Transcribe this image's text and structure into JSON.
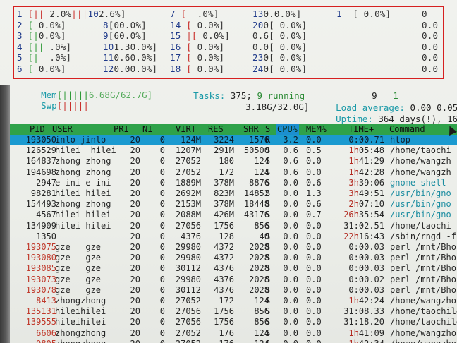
{
  "cpus": [
    {
      "num": "1",
      "bar": "||",
      "val": "2.0%",
      "bar_color": "r"
    },
    {
      "num": "2",
      "bar": "",
      "val": "0.0%"
    },
    {
      "num": "3",
      "bar": "|",
      "val": "0.0%",
      "bar_color": "r"
    },
    {
      "num": "4",
      "bar": "||",
      "val": ".0%",
      "bar_color": "g"
    },
    {
      "num": "5",
      "bar": "|",
      "val": ".0%",
      "bar_color": "g"
    },
    {
      "num": "6",
      "bar": "",
      "val": "0.0%"
    },
    {
      "num": "7",
      "bar": "",
      "val": ".0%"
    },
    {
      "num": "8",
      "bar": "",
      "val": "00.0%"
    },
    {
      "num": "9",
      "bar": "",
      "val": "60.0%"
    },
    {
      "num": "10",
      "bar": "",
      "val": "1.30.0%"
    },
    {
      "num": "11",
      "bar": "",
      "val": "0.60.0%"
    },
    {
      "num": "12",
      "bar": "",
      "val": "0.00.0%"
    },
    {
      "num": "13",
      "bar": "",
      "val": "0.0.0%"
    },
    {
      "num": "14",
      "bar": "|",
      "val": "0.0%"
    },
    {
      "num": "15",
      "bar": "|",
      "val": "0.0%"
    },
    {
      "num": "16",
      "bar": "",
      "val": "0.0%"
    },
    {
      "num": "17",
      "bar": "",
      "val": "0.0%"
    },
    {
      "num": "18",
      "bar": "",
      "val": "0.0%"
    },
    {
      "num": "1",
      "bar": "",
      "val": "0.0%"
    },
    {
      "num": "20",
      "bar": "",
      "val": "0.0%"
    },
    {
      "num": "21",
      "bar": "",
      "val": "0.0%"
    },
    {
      "num": "22",
      "bar": "",
      "val": "0.0%"
    },
    {
      "num": "23",
      "bar": "",
      "val": "0.0%"
    },
    {
      "num": "24",
      "bar": "",
      "val": "0.0%"
    }
  ],
  "cpu_labels_raw": {
    "r1": [
      "1",
      "[||",
      "2.0%|||10",
      "2.6%]",
      "7",
      "[",
      ".0%]",
      "13",
      "0.0.0%]",
      "1",
      "[",
      "0.0%]",
      "0"
    ],
    "col_right": [
      "0",
      "0.0",
      "0.0",
      "0.0",
      "0.0",
      "0.0"
    ]
  },
  "cpu_rows": [
    {
      "a": "1",
      "abar": "[||",
      "aval": " 2.0%",
      "mid": "|||10",
      "mval": "2.6%]",
      "b": "7",
      "bbar": "[",
      "bval": "  .0%]",
      "c": "13",
      "cval": "0.0.0%]",
      "d": "1",
      "dbar": "[",
      "dval": " 0.0%]",
      "e": "0"
    },
    {
      "a": "2",
      "abar": "[",
      "aval": " 0.0%]",
      "mid": "8",
      "mval": "[00.0%]",
      "b": "14",
      "bbar": "[",
      "bval": " 0.0%]",
      "c": "20",
      "cval": "0[ 0.0%]",
      "d": "",
      "dbar": "",
      "dval": "",
      "e": "0.0"
    },
    {
      "a": "3",
      "abar": "[|",
      "aval": "0.0%]",
      "mid": "9",
      "mval": "[60.0%]",
      "b": "15",
      "bbar": "|[",
      "bval": " 0.0%]",
      "c": "",
      "cval": "0.6[ 0.0%]",
      "d": "",
      "dbar": "",
      "dval": "",
      "e": "0.0"
    },
    {
      "a": "4",
      "abar": "[||",
      "aval": " .0%]",
      "mid": "10",
      "mval": "1.30.0%]",
      "b": "16",
      "bbar": "[",
      "bval": " 0.0%]",
      "c": "",
      "cval": "0.0[ 0.0%]",
      "d": "",
      "dbar": "",
      "dval": "",
      "e": "0.0"
    },
    {
      "a": "5",
      "abar": "[|",
      "aval": "  .0%]",
      "mid": "11",
      "mval": "0.60.0%]",
      "b": "17",
      "bbar": "[",
      "bval": " 0.0%]",
      "c": "23",
      "cval": "0[ 0.0%]",
      "d": "",
      "dbar": "",
      "dval": "",
      "e": "0.0"
    },
    {
      "a": "6",
      "abar": "[",
      "aval": " 0.0%]",
      "mid": "12",
      "mval": "0.00.0%]",
      "b": "18",
      "bbar": "[",
      "bval": " 0.0%]",
      "c": "24",
      "cval": "0[ 0.0%]",
      "d": "",
      "dbar": "",
      "dval": "",
      "e": "0.0"
    }
  ],
  "meters": {
    "mem_label": "Mem",
    "mem_bar": "[|||||",
    "mem_val": "6.68G/62.7G]",
    "swp_label": "Swp",
    "swp_bar": "[|||||",
    "swp_val": "3.18G/32.0G]",
    "tasks_label": "Tasks:",
    "tasks_count": "375;",
    "running": "9 running",
    "right_9": "9",
    "right_1": "1",
    "load_label": "Load average:",
    "load_vals": "0.00 0.05",
    "uptime_label": "Uptime:",
    "uptime_val": "364 days(!), 16:"
  },
  "columns": [
    "PID",
    "USER",
    "PRI",
    "NI",
    "VIRT",
    "RES",
    "SHR",
    "S",
    "CPU%",
    "MEM%",
    "TIME+",
    "Command"
  ],
  "processes": [
    {
      "pid": "193050",
      "user": "inlo jinlo",
      "pri": "20",
      "ni": "0",
      "virt": "124M",
      "res": "3224",
      "shr": "1576",
      "s": "R",
      "cpu": "3.2",
      "mem": "0.0",
      "time_h": "",
      "time": "0:00.71",
      "cmd": "htop",
      "selected": true
    },
    {
      "pid": "126529",
      "user": "hilei  hilei",
      "pri": "20",
      "ni": "0",
      "virt": "1207M",
      "res": "291M",
      "shr": "50500",
      "s": "S",
      "cpu": "0.6",
      "mem": "0.5",
      "time_h": "1h",
      "time": "05:48",
      "cmd": "/home/taochi"
    },
    {
      "pid": "164837",
      "user": "zhong zhong",
      "pri": "20",
      "ni": "0",
      "virt": "27052",
      "res": "180",
      "shr": "124",
      "s": "S",
      "cpu": "0.6",
      "mem": "0.0",
      "time_h": "1h",
      "time": "41:29",
      "cmd": "/home/wangzh"
    },
    {
      "pid": "194698",
      "user": "zhong zhong",
      "pri": "20",
      "ni": "0",
      "virt": "27052",
      "res": "172",
      "shr": "124",
      "s": "S",
      "cpu": "0.6",
      "mem": "0.0",
      "time_h": "1h",
      "time": "42:28",
      "cmd": "/home/wangzh"
    },
    {
      "pid": "2947",
      "user": "e-ini e-ini",
      "pri": "20",
      "ni": "0",
      "virt": "1889M",
      "res": "378M",
      "shr": "8876",
      "s": "S",
      "cpu": "0.0",
      "mem": "0.6",
      "time_h": "3h",
      "time": "39:06",
      "cmd": "gnome-shell"
    },
    {
      "pid": "98281",
      "user": "hilei hilei",
      "pri": "20",
      "ni": "0",
      "virt": "2692M",
      "res": "823M",
      "shr": "14852",
      "s": "S",
      "cpu": "0.0",
      "mem": "1.3",
      "time_h": "3h",
      "time": "49:51",
      "cmd": "/usr/bin/gno"
    },
    {
      "pid": "154493",
      "user": "zhong zhong",
      "pri": "20",
      "ni": "0",
      "virt": "2153M",
      "res": "378M",
      "shr": "18448",
      "s": "S",
      "cpu": "0.0",
      "mem": "0.6",
      "time_h": "2h",
      "time": "07:10",
      "cmd": "/usr/bin/gno"
    },
    {
      "pid": "4567",
      "user": "hilei hilei",
      "pri": "20",
      "ni": "0",
      "virt": "2088M",
      "res": "426M",
      "shr": "43176",
      "s": "S",
      "cpu": "0.0",
      "mem": "0.7",
      "time_h": "26h",
      "time": "35:54",
      "cmd": "/usr/bin/gno"
    },
    {
      "pid": "134909",
      "user": "hilei hilei",
      "pri": "20",
      "ni": "0",
      "virt": "27056",
      "res": "1756",
      "shr": "856",
      "s": "S",
      "cpu": "0.0",
      "mem": "0.0",
      "time_h": "",
      "time": "31:02.51",
      "cmd": "/home/taochi"
    },
    {
      "pid": "1350",
      "user": "",
      "pri": "20",
      "ni": "0",
      "virt": "4376",
      "res": "128",
      "shr": "40",
      "s": "S",
      "cpu": "0.0",
      "mem": "0.0",
      "time_h": "22h",
      "time": "16:43",
      "cmd": "/sbin/rngd -f"
    },
    {
      "pid": "193075",
      "user": "gze   gze",
      "pri": "20",
      "ni": "0",
      "virt": "29980",
      "res": "4372",
      "shr": "2028",
      "s": "S",
      "cpu": "0.0",
      "mem": "0.0",
      "time_h": "",
      "time": "0:00.03",
      "cmd": "perl /mnt/Bho"
    },
    {
      "pid": "193080",
      "user": "gze   gze",
      "pri": "20",
      "ni": "0",
      "virt": "29980",
      "res": "4372",
      "shr": "2028",
      "s": "S",
      "cpu": "0.0",
      "mem": "0.0",
      "time_h": "",
      "time": "0:00.03",
      "cmd": "perl /mnt/Bho"
    },
    {
      "pid": "193085",
      "user": "gze   gze",
      "pri": "20",
      "ni": "0",
      "virt": "30112",
      "res": "4376",
      "shr": "2028",
      "s": "S",
      "cpu": "0.0",
      "mem": "0.0",
      "time_h": "",
      "time": "0:00.03",
      "cmd": "perl /mnt/Bho"
    },
    {
      "pid": "193073",
      "user": "gze   gze",
      "pri": "20",
      "ni": "0",
      "virt": "29980",
      "res": "4376",
      "shr": "2028",
      "s": "S",
      "cpu": "0.0",
      "mem": "0.0",
      "time_h": "",
      "time": "0:00.02",
      "cmd": "perl /mnt/Bho"
    },
    {
      "pid": "193078",
      "user": "gze   gze",
      "pri": "20",
      "ni": "0",
      "virt": "30112",
      "res": "4376",
      "shr": "2028",
      "s": "S",
      "cpu": "0.0",
      "mem": "0.0",
      "time_h": "",
      "time": "0:00.03",
      "cmd": "perl /mnt/Bhor"
    },
    {
      "pid": "8413",
      "user": "zhongzhong",
      "pri": "20",
      "ni": "0",
      "virt": "27052",
      "res": "172",
      "shr": "124",
      "s": "S",
      "cpu": "0.0",
      "mem": "0.0",
      "time_h": "1h",
      "time": "42:24",
      "cmd": "/home/wangzhon"
    },
    {
      "pid": "135131",
      "user": "hileihilei",
      "pri": "20",
      "ni": "0",
      "virt": "27056",
      "res": "1756",
      "shr": "856",
      "s": "S",
      "cpu": "0.0",
      "mem": "0.0",
      "time_h": "",
      "time": "31:08.33",
      "cmd": "/home/taochile"
    },
    {
      "pid": "139555",
      "user": "hileihilei",
      "pri": "20",
      "ni": "0",
      "virt": "27056",
      "res": "1756",
      "shr": "856",
      "s": "S",
      "cpu": "0.0",
      "mem": "0.0",
      "time_h": "",
      "time": "31:18.20",
      "cmd": "/home/taochile"
    },
    {
      "pid": "6606",
      "user": "zhongzhong",
      "pri": "20",
      "ni": "0",
      "virt": "27052",
      "res": "176",
      "shr": "124",
      "s": "S",
      "cpu": "0.0",
      "mem": "0.0",
      "time_h": "1h",
      "time": "41:09",
      "cmd": "/home/wangzhon"
    },
    {
      "pid": "9805",
      "user": "zhongzhong",
      "pri": "20",
      "ni": "0",
      "virt": "27052",
      "res": "176",
      "shr": "124",
      "s": "S",
      "cpu": "0.0",
      "mem": "0.0",
      "time_h": "1h",
      "time": "42:34",
      "cmd": "/home/wangzhon"
    },
    {
      "pid": "10035",
      "user": "zhongzhong",
      "pri": "20",
      "ni": "0",
      "virt": "27052",
      "res": "176",
      "shr": "124",
      "s": "S",
      "cpu": "0.0",
      "mem": "0.0",
      "time_h": "1h",
      "time": "42:23",
      "cmd": "/home/wangzhon"
    }
  ]
}
